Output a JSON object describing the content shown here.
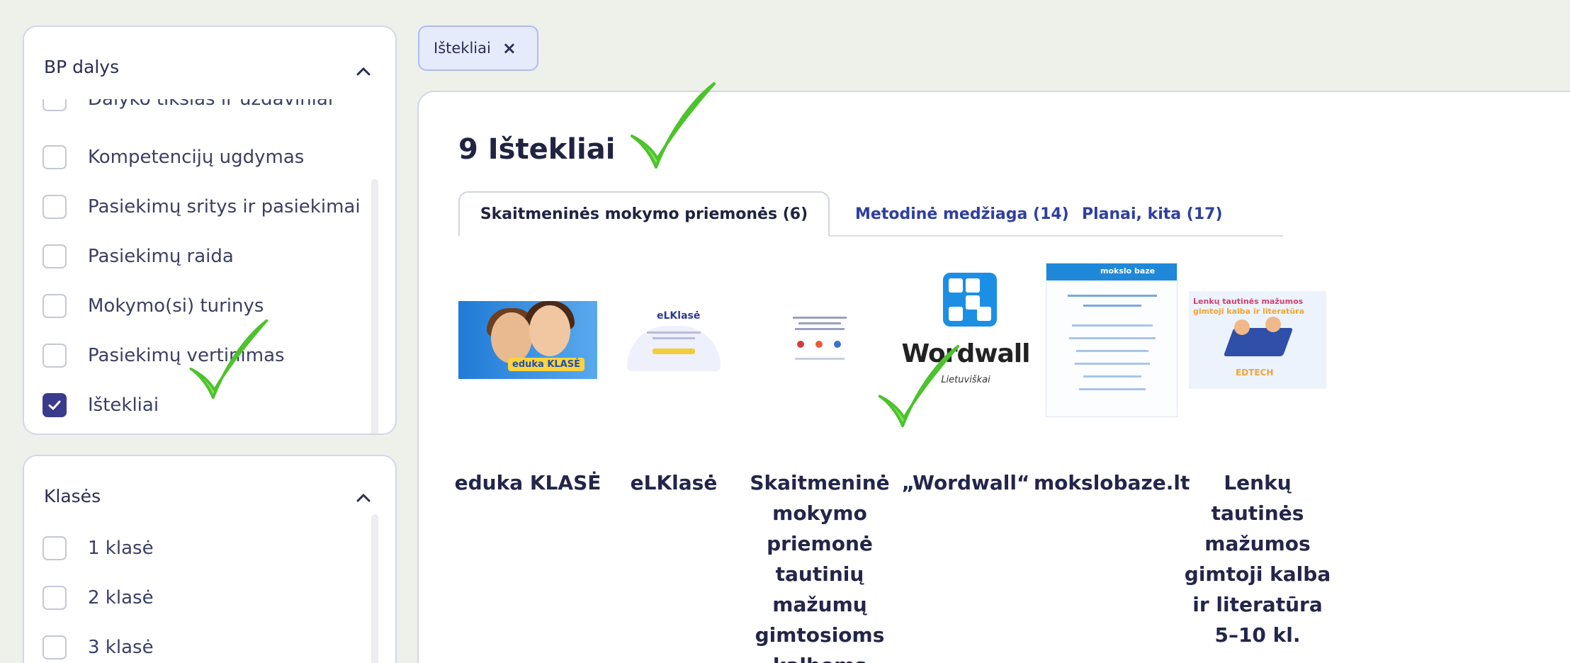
{
  "sidebar": {
    "bp_dalys": {
      "title": "BP dalys",
      "items": [
        {
          "label": "Dalyko tikslas ir uždaviniai",
          "checked": false
        },
        {
          "label": "Kompetencijų ugdymas",
          "checked": false
        },
        {
          "label": "Pasiekimų sritys ir pasiekimai",
          "checked": false
        },
        {
          "label": "Pasiekimų raida",
          "checked": false
        },
        {
          "label": "Mokymo(si) turinys",
          "checked": false
        },
        {
          "label": "Pasiekimų vertinimas",
          "checked": false
        },
        {
          "label": "Ištekliai",
          "checked": true
        }
      ]
    },
    "klases": {
      "title": "Klasės",
      "items": [
        {
          "label": "1 klasė",
          "checked": false
        },
        {
          "label": "2 klasė",
          "checked": false
        },
        {
          "label": "3 klasė",
          "checked": false
        }
      ]
    }
  },
  "filter_tag": {
    "label": "Ištekliai",
    "remove_icon": "×"
  },
  "main": {
    "title": "9 Ištekliai",
    "tabs": [
      {
        "label": "Skaitmeninės mokymo priemonės (6)",
        "active": true
      },
      {
        "label": "Metodinė medžiaga (14)",
        "active": false
      },
      {
        "label": "Planai, kita (17)",
        "active": false
      }
    ],
    "resources": [
      {
        "title": "eduka KLASĖ",
        "thumb_text": "eduka KLASĖ"
      },
      {
        "title": "eLKlasė",
        "thumb_text": "eLKlasė"
      },
      {
        "title": "Skaitmeninė mokymo priemonė tautinių mažumų gimtosioms kalboms"
      },
      {
        "title": "„Wordwall“",
        "thumb_text": "Wordwall",
        "thumb_sub": "Lietuviškai"
      },
      {
        "title": "mokslobaze.lt",
        "thumb_text": "mokslo baze"
      },
      {
        "title": "Lenkų tautinės mažumos gimtoji kalba ir literatūra 5–10 kl.",
        "thumb_text_1": "Lenkų tautinės mažumos",
        "thumb_text_2": "gimtoji kalba ir literatūra",
        "thumb_logo": "EDTECH"
      }
    ]
  },
  "colors": {
    "accent": "#3a3b8c",
    "tab_link": "#2f3f9e",
    "annotation_check": "#5fd23a",
    "background": "#eef0ea"
  }
}
